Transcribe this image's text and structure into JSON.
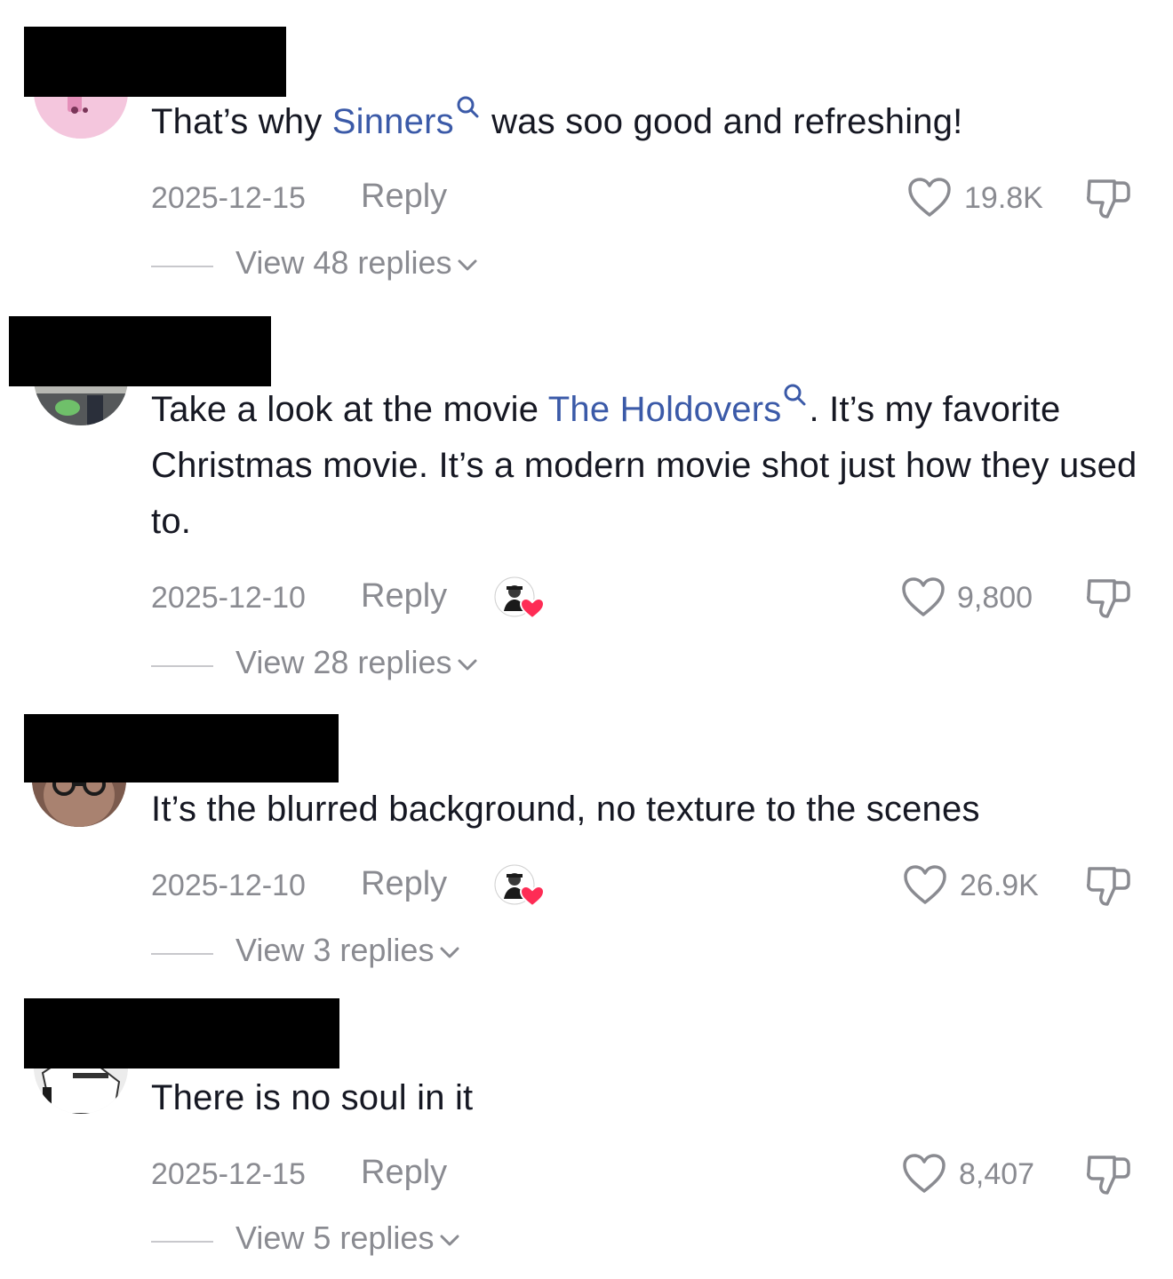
{
  "comments": [
    {
      "text_before": "That’s why ",
      "link": "Sinners",
      "text_after": " was soo good and refreshing!",
      "date": "2025-12-15",
      "reply_label": "Reply",
      "likes": "19.8K",
      "view_replies": "View 48 replies",
      "creator_liked": false
    },
    {
      "text_before": "Take a look at the movie ",
      "link": "The Holdovers",
      "text_after": ". It’s my favorite Christmas movie. It’s a modern movie shot just how they used to.",
      "date": "2025-12-10",
      "reply_label": "Reply",
      "likes": "9,800",
      "view_replies": "View 28 replies",
      "creator_liked": true
    },
    {
      "text_before": "It’s the blurred background, no texture to the scenes",
      "link": "",
      "text_after": "",
      "date": "2025-12-10",
      "reply_label": "Reply",
      "likes": "26.9K",
      "view_replies": "View 3 replies",
      "creator_liked": true
    },
    {
      "text_before": "There is no soul in it",
      "link": "",
      "text_after": "",
      "date": "2025-12-15",
      "reply_label": "Reply",
      "likes": "8,407",
      "view_replies": "View 5 replies",
      "creator_liked": false
    }
  ],
  "colors": {
    "link": "#3b5aa8",
    "meta_gray": "#8a8b91",
    "text": "#161823",
    "creator_heart": "#fe2c55"
  },
  "icons": {
    "like": "heart-outline-icon",
    "dislike": "thumbs-down-outline-icon",
    "link_search": "search-icon",
    "expand": "chevron-down-icon",
    "creator_like": "creator-liked-avatar-icon"
  }
}
